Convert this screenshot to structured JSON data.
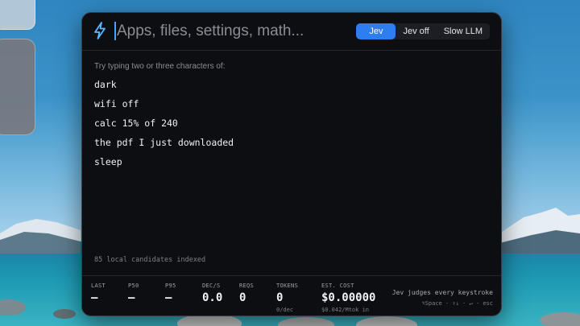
{
  "search": {
    "placeholder": "Apps, files, settings, math..."
  },
  "modes": [
    {
      "label": "Jev",
      "active": true
    },
    {
      "label": "Jev off",
      "active": false
    },
    {
      "label": "Slow LLM",
      "active": false
    }
  ],
  "hint": "Try typing two or three characters of:",
  "suggestions": [
    "dark",
    "wifi off",
    "calc 15% of 240",
    "the pdf I just downloaded",
    "sleep"
  ],
  "indexed_text": "85 local candidates indexed",
  "stats": {
    "last": {
      "label": "LAST",
      "value": "—"
    },
    "p50": {
      "label": "P50",
      "value": "—"
    },
    "p95": {
      "label": "P95",
      "value": "—"
    },
    "dec": {
      "label": "DEC/S",
      "value": "0.0"
    },
    "reqs": {
      "label": "REQS",
      "value": "0"
    },
    "tokens": {
      "label": "TOKENS",
      "value": "0",
      "sub": "0/dec"
    },
    "cost": {
      "label": "EST. COST",
      "value": "$0.00000",
      "sub": "$0.042/Mtok in"
    }
  },
  "footer": {
    "judge": "Jev judges every keystroke",
    "keys": "⌥Space · ↑↓ · ↵ · esc"
  },
  "colors": {
    "accent": "#2d7ef0",
    "bolt": "#5ab8ff",
    "window_bg": "#0d0e12"
  },
  "icons": {
    "launcher": "lightning-bolt-icon"
  }
}
